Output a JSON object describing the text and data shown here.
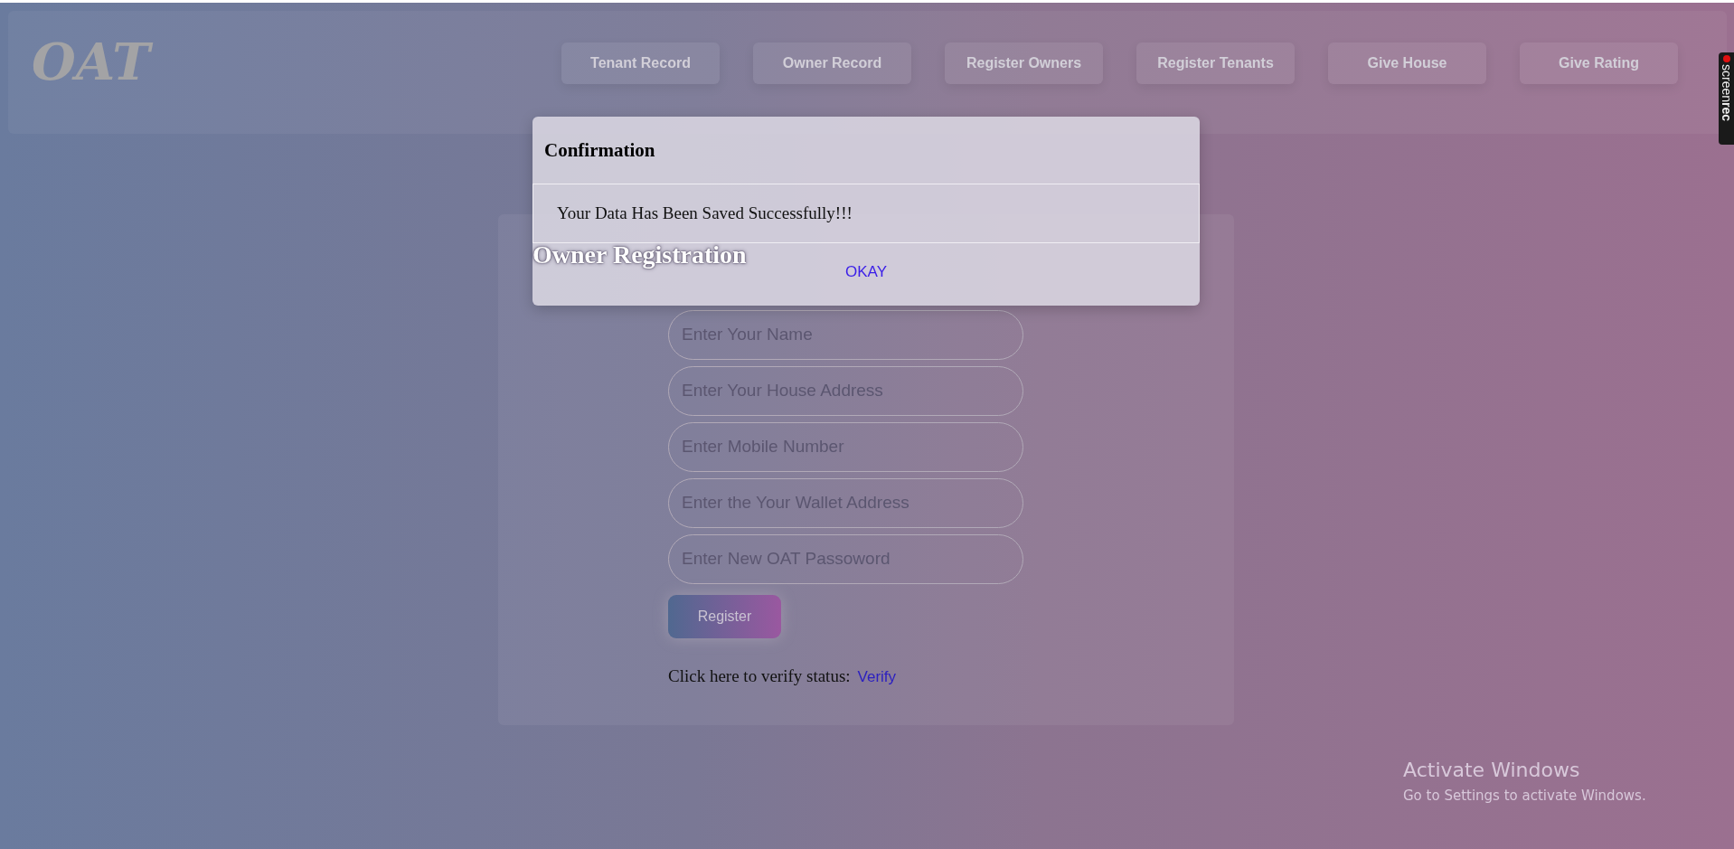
{
  "header": {
    "logo": "OAT",
    "nav": [
      {
        "label": "Tenant Record"
      },
      {
        "label": "Owner Record"
      },
      {
        "label": "Register Owners"
      },
      {
        "label": "Register Tenants"
      },
      {
        "label": "Give House"
      },
      {
        "label": "Give Rating"
      }
    ]
  },
  "form": {
    "title": "Owner Registration",
    "fields": [
      {
        "placeholder": "Enter Your Name"
      },
      {
        "placeholder": "Enter Your House Address"
      },
      {
        "placeholder": "Enter Mobile Number"
      },
      {
        "placeholder": "Enter the Your Wallet Address"
      },
      {
        "placeholder": "Enter New OAT Passoword"
      }
    ],
    "submit": "Register",
    "verify_text": "Click here to verify status:",
    "verify_link": "Verify"
  },
  "dialog": {
    "title": "Confirmation",
    "message": "Your Data Has Been Saved Successfully!!!",
    "button": "OKAY"
  },
  "os_notice": {
    "title": "Activate Windows",
    "subtitle": "Go to Settings to activate Windows."
  },
  "recorder_badge": {
    "label": "screen",
    "label_bold": "rec"
  }
}
